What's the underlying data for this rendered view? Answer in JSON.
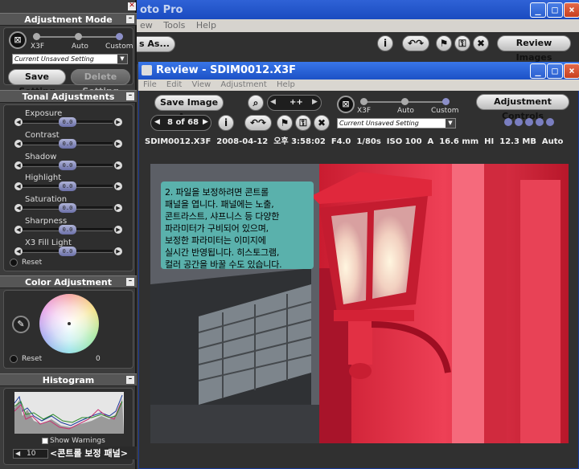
{
  "main_window": {
    "title": "oto Pro",
    "menu": [
      "ew",
      "Tools",
      "Help"
    ],
    "save_as_partial": "s As...",
    "review_images": "Review Images"
  },
  "left_panel": {
    "adjustment_mode": {
      "title": "Adjustment Mode",
      "modes": [
        "X3F",
        "Auto",
        "Custom"
      ],
      "setting_value": "Current Unsaved Setting",
      "save_button": "Save Setting",
      "delete_button": "Delete Setting"
    },
    "tonal": {
      "title": "Tonal Adjustments",
      "sliders": [
        {
          "label": "Exposure",
          "value": "0.0"
        },
        {
          "label": "Contrast",
          "value": "0.0"
        },
        {
          "label": "Shadow",
          "value": "0.0"
        },
        {
          "label": "Highlight",
          "value": "0.0"
        },
        {
          "label": "Saturation",
          "value": "0.0"
        },
        {
          "label": "Sharpness",
          "value": "0.0"
        },
        {
          "label": "X3 Fill Light",
          "value": "0.0"
        }
      ],
      "reset": "Reset"
    },
    "color": {
      "title": "Color Adjustment",
      "reset": "Reset",
      "value": "0"
    },
    "histogram": {
      "title": "Histogram",
      "show_warnings": "Show Warnings",
      "level": "10"
    },
    "caption": "<콘트롤 보정 패널>"
  },
  "review": {
    "title": "Review - SDIM0012.X3F",
    "menu": [
      "File",
      "Edit",
      "View",
      "Adjustment",
      "Help"
    ],
    "save_image_as": "Save Image As...",
    "zoom": "++",
    "page": "8 of 68",
    "modes": [
      "X3F",
      "Auto",
      "Custom"
    ],
    "setting_value": "Current Unsaved Setting",
    "adjustment_controls": "Adjustment Controls",
    "info": "SDIM0012.X3F  2008-04-12  오후 3:58:02  F4.0  1/80s  ISO 100  A  16.6 mm  HI  12.3 MB  Auto",
    "note_lines": [
      "2. 파일을 보정하려면 콘트롤",
      "패널을 엽니다. 패널에는 노출,",
      "콘트라스트, 샤프니스 등 다양한",
      "파라미터가 구비되어 있으며,",
      "보정한 파라미터는 이미지에",
      "실시간 반영됩니다. 히스토그램,",
      "컬러 공간을 바꿀 수도 있습니다."
    ]
  },
  "colors": {
    "titlebar": "#2a5fd0",
    "panel_bg": "#3c3c3c",
    "note_bg": "#5ab1ac",
    "lamp_red": "#e0283c"
  }
}
